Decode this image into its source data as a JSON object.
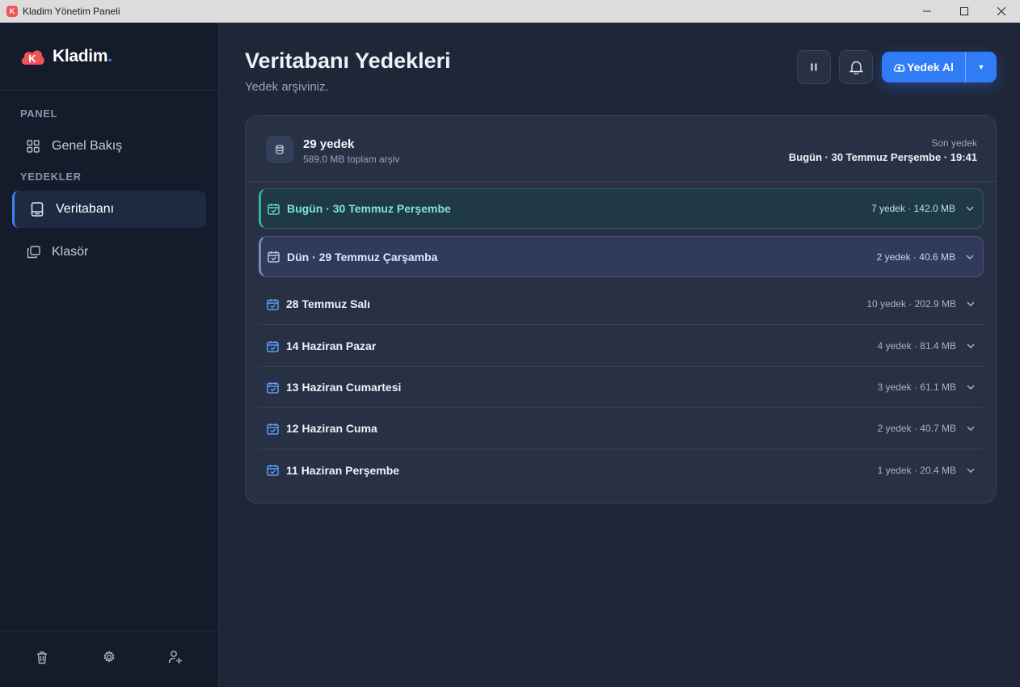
{
  "window": {
    "title": "Kladim Yönetim Paneli",
    "icon_letter": "K"
  },
  "sidebar": {
    "brand": {
      "name": "Kladim",
      "dot": ".",
      "logo_letter": "K"
    },
    "sections": [
      {
        "label": "PANEL",
        "items": [
          {
            "label": "Genel Bakış",
            "icon": "dashboard-icon",
            "active": false
          }
        ]
      },
      {
        "label": "YEDEKLER",
        "items": [
          {
            "label": "Veritabanı",
            "icon": "database-icon",
            "active": true
          },
          {
            "label": "Klasör",
            "icon": "folders-icon",
            "active": false
          }
        ]
      }
    ],
    "bottom_icons": [
      "trash-icon",
      "gear-icon",
      "user-settings-icon"
    ]
  },
  "header": {
    "title": "Veritabanı Yedekleri",
    "subtitle": "Yedek arşiviniz.",
    "primary_button_label": "Yedek Al"
  },
  "summary": {
    "count": "29 yedek",
    "total": "589.0 MB toplam arşiv",
    "last_label": "Son yedek",
    "last_value": "Bugün · 30 Temmuz Perşembe · 19:41"
  },
  "groups": [
    {
      "label": "Bugün · 30 Temmuz Perşembe",
      "meta": "7 yedek · 142.0 MB",
      "style": "today"
    },
    {
      "label": "Dün · 29 Temmuz Çarşamba",
      "meta": "2 yedek · 40.6 MB",
      "style": "yesterday"
    },
    {
      "label": "28 Temmuz Salı",
      "meta": "10 yedek · 202.9 MB",
      "style": "plain"
    },
    {
      "label": "14 Haziran Pazar",
      "meta": "4 yedek · 81.4 MB",
      "style": "plain"
    },
    {
      "label": "13 Haziran Cumartesi",
      "meta": "3 yedek · 61.1 MB",
      "style": "plain"
    },
    {
      "label": "12 Haziran Cuma",
      "meta": "2 yedek · 40.7 MB",
      "style": "plain"
    },
    {
      "label": "11 Haziran Perşembe",
      "meta": "1 yedek · 20.4 MB",
      "style": "plain"
    }
  ],
  "colors": {
    "accent": "#2f7cf6",
    "today_accent": "#2fb39b",
    "yesterday_accent": "#7b86b8",
    "logo_red": "#f0535a"
  }
}
